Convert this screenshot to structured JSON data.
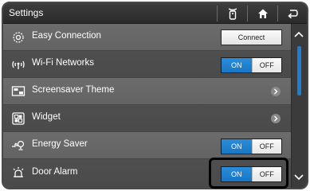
{
  "header": {
    "title": "Settings",
    "buttons": [
      "remote-icon",
      "home-icon",
      "back-icon"
    ]
  },
  "rows": [
    {
      "label": "Easy Connection",
      "icon": "easy-connection-icon",
      "control": "button",
      "button_label": "Connect"
    },
    {
      "label": "Wi-Fi Networks",
      "icon": "wifi-icon",
      "control": "toggle",
      "on_label": "ON",
      "off_label": "OFF",
      "state": "ON"
    },
    {
      "label": "Screensaver Theme",
      "icon": "screensaver-icon",
      "control": "chevron"
    },
    {
      "label": "Widget",
      "icon": "widget-icon",
      "control": "chevron"
    },
    {
      "label": "Energy Saver",
      "icon": "energy-saver-icon",
      "control": "toggle",
      "on_label": "ON",
      "off_label": "OFF",
      "state": "ON"
    },
    {
      "label": "Door Alarm",
      "icon": "door-alarm-icon",
      "control": "toggle",
      "on_label": "ON",
      "off_label": "OFF",
      "state": "ON"
    }
  ],
  "colors": {
    "accent": "#1877c4",
    "header_bg": "#2b2b2b",
    "row_light": "#6c6c6c",
    "row_dark": "#4a4a4a"
  }
}
